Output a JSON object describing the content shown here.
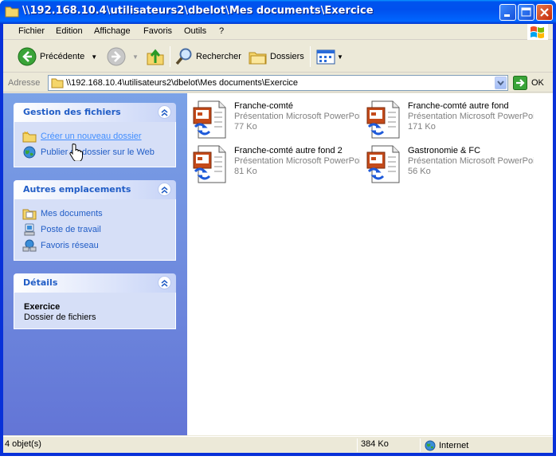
{
  "window": {
    "title": "\\\\192.168.10.4\\utilisateurs2\\dbelot\\Mes documents\\Exercice"
  },
  "menu": {
    "items": [
      "Fichier",
      "Edition",
      "Affichage",
      "Favoris",
      "Outils",
      "?"
    ]
  },
  "toolbar": {
    "back_label": "Précédente",
    "search_label": "Rechercher",
    "folders_label": "Dossiers"
  },
  "address": {
    "label": "Adresse",
    "value": "\\\\192.168.10.4\\utilisateurs2\\dbelot\\Mes documents\\Exercice",
    "go_label": "OK"
  },
  "panels": {
    "file_tasks": {
      "title": "Gestion des fichiers",
      "links": [
        "Créer un nouveau dossier",
        "Publier ce dossier sur le Web"
      ]
    },
    "other_places": {
      "title": "Autres emplacements",
      "links": [
        "Mes documents",
        "Poste de travail",
        "Favoris réseau"
      ]
    },
    "details": {
      "title": "Détails",
      "name": "Exercice",
      "type": "Dossier de fichiers"
    }
  },
  "files": [
    {
      "name": "Franche-comté",
      "type": "Présentation Microsoft PowerPoint",
      "size": "77 Ko"
    },
    {
      "name": "Franche-comté autre fond",
      "type": "Présentation Microsoft PowerPoint",
      "size": "171 Ko"
    },
    {
      "name": "Franche-comté autre fond 2",
      "type": "Présentation Microsoft PowerPoint",
      "size": "81 Ko"
    },
    {
      "name": "Gastronomie & FC",
      "type": "Présentation Microsoft PowerPoint",
      "size": "56 Ko"
    }
  ],
  "status": {
    "objects": "4 objet(s)",
    "size": "384 Ko",
    "zone": "Internet"
  },
  "colors": {
    "title_bar": "#0058ee",
    "panel_bg": "#7ba2e7",
    "link": "#215dc6"
  },
  "icons": [
    "folder-icon",
    "back-arrow-icon",
    "forward-arrow-icon",
    "up-folder-icon",
    "search-icon",
    "folders-icon",
    "views-icon",
    "go-arrow-icon",
    "new-folder-icon",
    "globe-icon",
    "my-documents-icon",
    "my-computer-icon",
    "network-icon",
    "powerpoint-file-icon",
    "internet-zone-icon"
  ]
}
